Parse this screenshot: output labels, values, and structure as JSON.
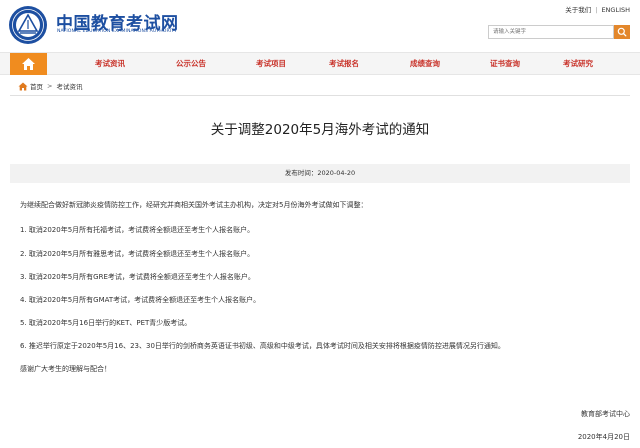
{
  "header": {
    "logo_title": "中国教育考试网",
    "logo_subtitle": "NATIONAL EDUCATION EXAMINATIONS AUTHORITY",
    "top_links": {
      "about": "关于我们",
      "separator": "|",
      "english": "ENGLISH"
    },
    "search": {
      "placeholder": "请输入关键字"
    }
  },
  "nav": {
    "items": [
      {
        "label": "考试资讯"
      },
      {
        "label": "公示公告"
      },
      {
        "label": "考试项目"
      },
      {
        "label": "考试报名"
      },
      {
        "label": "成绩查询"
      },
      {
        "label": "证书查询"
      },
      {
        "label": "考试研究"
      }
    ]
  },
  "breadcrumb": {
    "home": "首页",
    "separator": ">",
    "current": "考试资讯"
  },
  "article": {
    "title": "关于调整2020年5月海外考试的通知",
    "publish_time": "发布时间：2020-04-20",
    "intro": "为继续配合做好新冠肺炎疫情防控工作，经研究并商相关国外考试主办机构，决定对5月份海外考试做如下调整：",
    "items": [
      "1. 取消2020年5月所有托福考试，考试费将全额退还至考生个人报名账户。",
      "2. 取消2020年5月所有雅思考试，考试费将全额退还至考生个人报名账户。",
      "3. 取消2020年5月所有GRE考试，考试费将全额退还至考生个人报名账户。",
      "4. 取消2020年5月所有GMAT考试，考试费将全额退还至考生个人报名账户。",
      "5. 取消2020年5月16日举行的KET、PET青少版考试。",
      "6. 推迟举行原定于2020年5月16、23、30日举行的剑桥商务英语证书初级、高级和中级考试，具体考试时间及相关安排将根据疫情防控进展情况另行通知。"
    ],
    "closing": "感谢广大考生的理解与配合！",
    "signature_org": "教育部考试中心",
    "signature_date": "2020年4月20日"
  },
  "colors": {
    "brand_blue": "#1d4fa1",
    "nav_accent": "#f08c1f",
    "nav_text": "#c9342b",
    "search_button": "#e3872b"
  },
  "icons": {
    "emblem": "neea-emblem-icon",
    "home": "home-icon",
    "breadcrumb_home": "house-icon",
    "search": "search-icon"
  }
}
